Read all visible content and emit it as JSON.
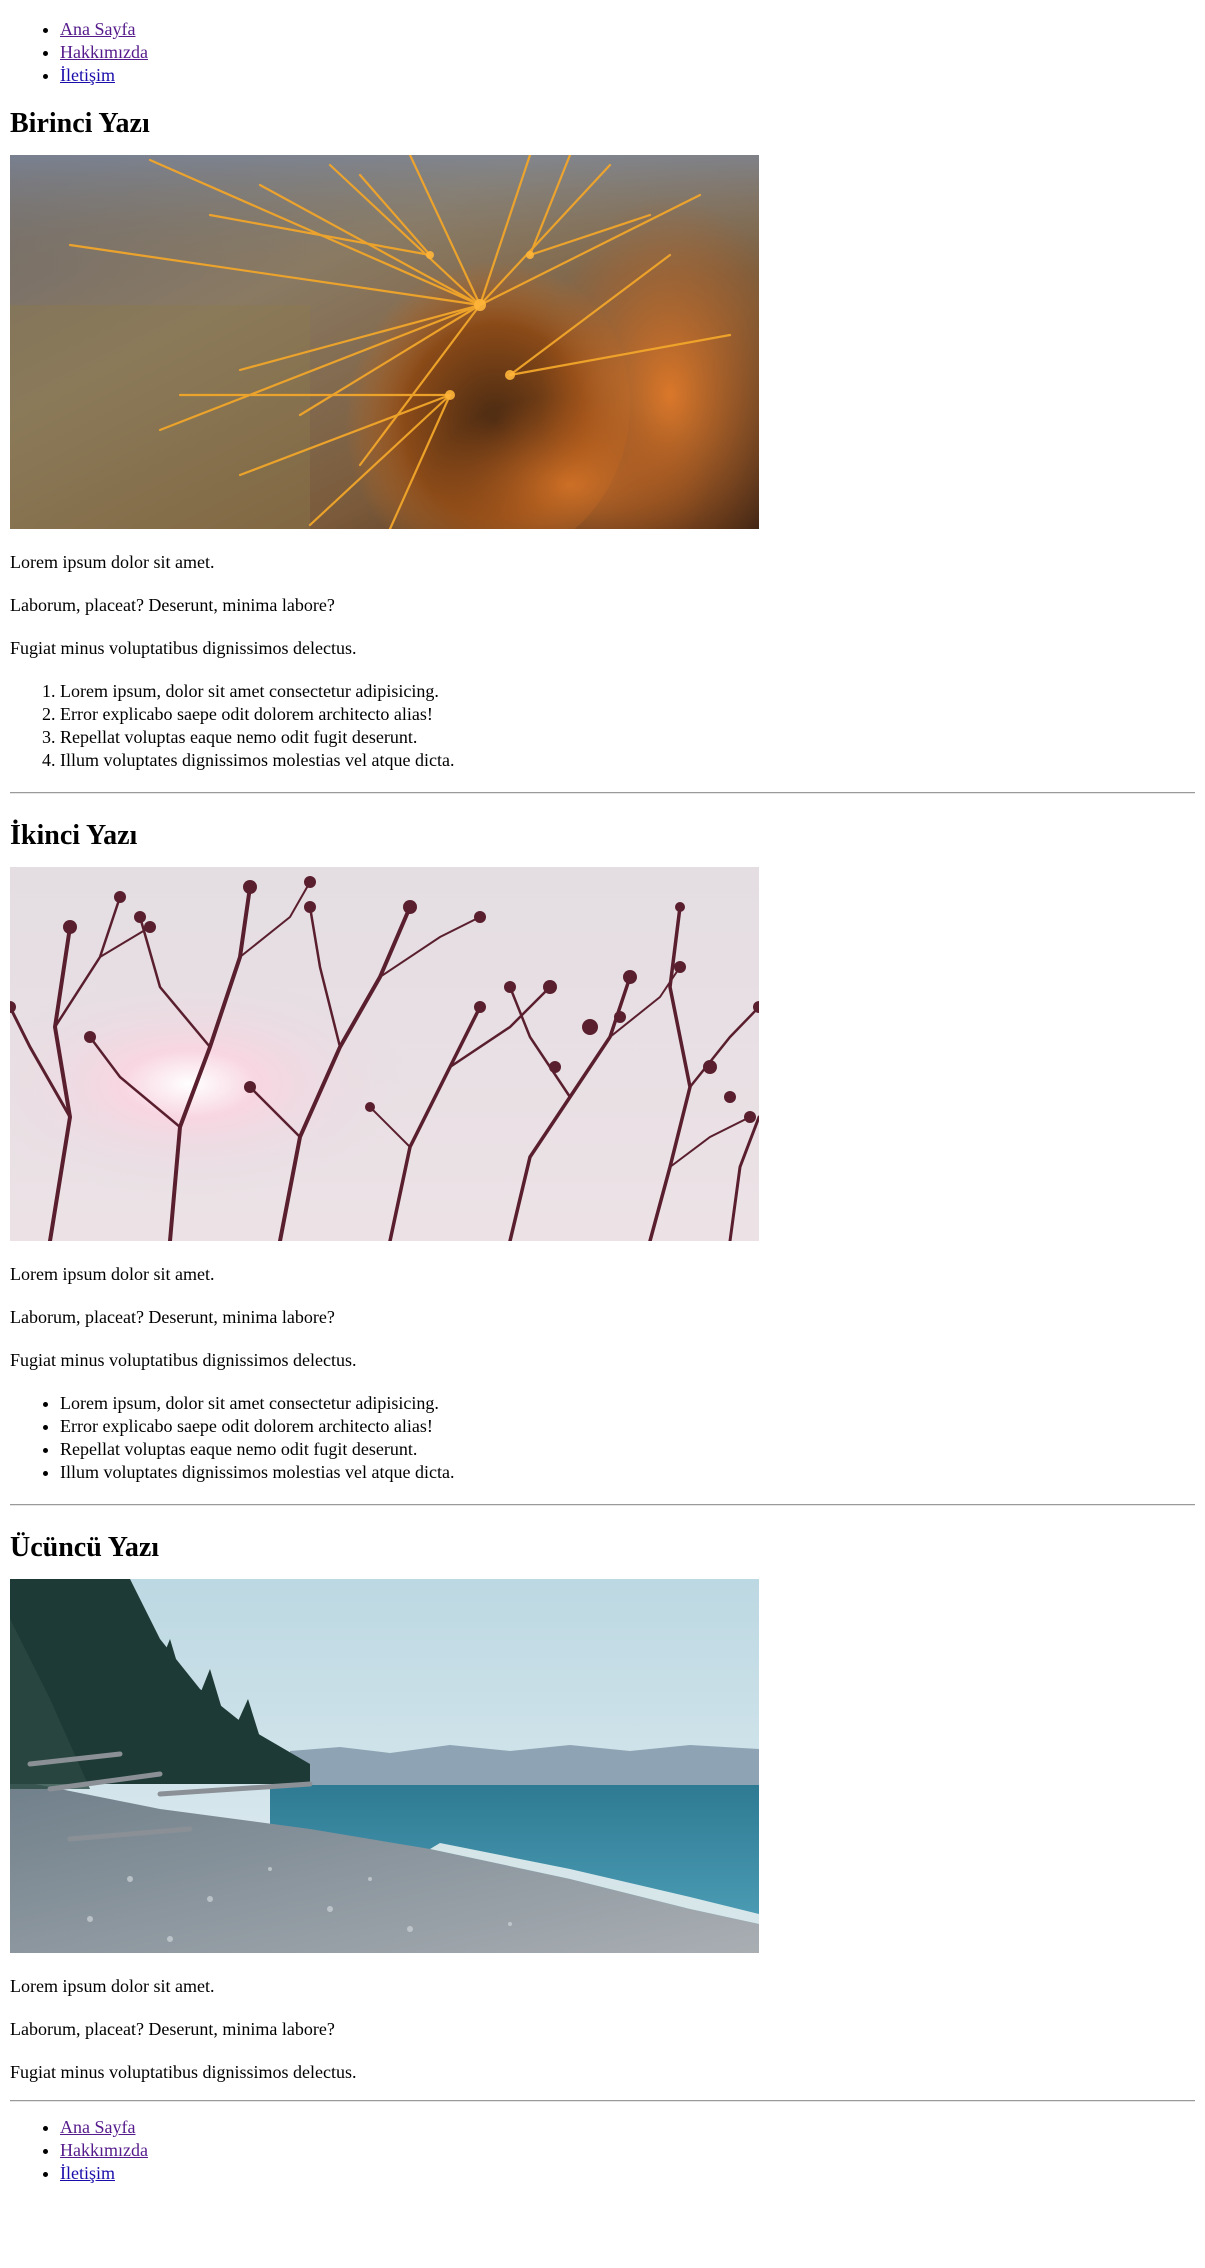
{
  "nav": {
    "items": [
      {
        "label": "Ana Sayfa"
      },
      {
        "label": "Hakkımızda"
      },
      {
        "label": "İletişim"
      }
    ]
  },
  "posts": [
    {
      "title": "Birinci Yazı",
      "image_icon": "cactus-photo",
      "paragraphs": [
        "Lorem ipsum dolor sit amet.",
        "Laborum, placeat? Deserunt, minima labore?",
        "Fugiat minus voluptatibus dignissimos delectus."
      ],
      "list_type": "ordered",
      "list": [
        "Lorem ipsum, dolor sit amet consectetur adipisicing.",
        "Error explicabo saepe odit dolorem architecto alias!",
        "Repellat voluptas eaque nemo odit fugit deserunt.",
        "Illum voluptates dignissimos molestias vel atque dicta."
      ]
    },
    {
      "title": "İkinci Yazı",
      "image_icon": "branches-photo",
      "paragraphs": [
        "Lorem ipsum dolor sit amet.",
        "Laborum, placeat? Deserunt, minima labore?",
        "Fugiat minus voluptatibus dignissimos delectus."
      ],
      "list_type": "unordered",
      "list": [
        "Lorem ipsum, dolor sit amet consectetur adipisicing.",
        "Error explicabo saepe odit dolorem architecto alias!",
        "Repellat voluptas eaque nemo odit fugit deserunt.",
        "Illum voluptates dignissimos molestias vel atque dicta."
      ]
    },
    {
      "title": "Ücüncü Yazı",
      "image_icon": "beach-photo",
      "paragraphs": [
        "Lorem ipsum dolor sit amet.",
        "Laborum, placeat? Deserunt, minima labore?",
        "Fugiat minus voluptatibus dignissimos delectus."
      ]
    }
  ],
  "footer_nav": {
    "items": [
      {
        "label": "Ana Sayfa"
      },
      {
        "label": "Hakkımızda"
      },
      {
        "label": "İletişim"
      }
    ]
  },
  "colors": {
    "link": "#1a0dab",
    "link_visited": "#551a8b",
    "text": "#000000",
    "rule": "#9a9a9a"
  }
}
